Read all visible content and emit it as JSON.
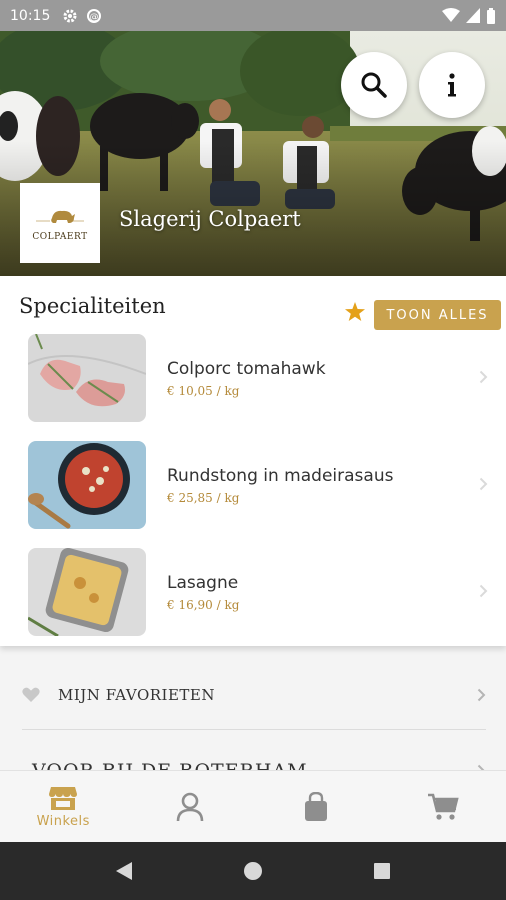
{
  "status_bar": {
    "time": "10:15"
  },
  "hero": {
    "shop_name": "Slagerij Colpaert",
    "logo_text": "COLPAERT"
  },
  "specialties": {
    "title": "Specialiteiten",
    "show_all_label": "TOON ALLES",
    "products": [
      {
        "name": "Colporc tomahawk",
        "price": "€ 10,05 / kg"
      },
      {
        "name": "Rundstong in madeirasaus",
        "price": "€ 25,85 / kg"
      },
      {
        "name": "Lasagne",
        "price": "€ 16,90 / kg"
      }
    ]
  },
  "lists": {
    "favorites_label": "MIJN FAVORIETEN",
    "sandwich_label": "VOOR BIJ DE BOTERHAM"
  },
  "bottom_nav": {
    "items": [
      {
        "label": "Winkels",
        "icon": "store-icon",
        "active": true
      },
      {
        "label": "",
        "icon": "user-icon",
        "active": false
      },
      {
        "label": "",
        "icon": "shopping-bag-icon",
        "active": false
      },
      {
        "label": "",
        "icon": "cart-icon",
        "active": false
      }
    ]
  },
  "colors": {
    "accent": "#c9a24e",
    "price": "#b48a3a",
    "status_bar": "#9a9a9a",
    "system_nav": "#2a2a2a"
  }
}
